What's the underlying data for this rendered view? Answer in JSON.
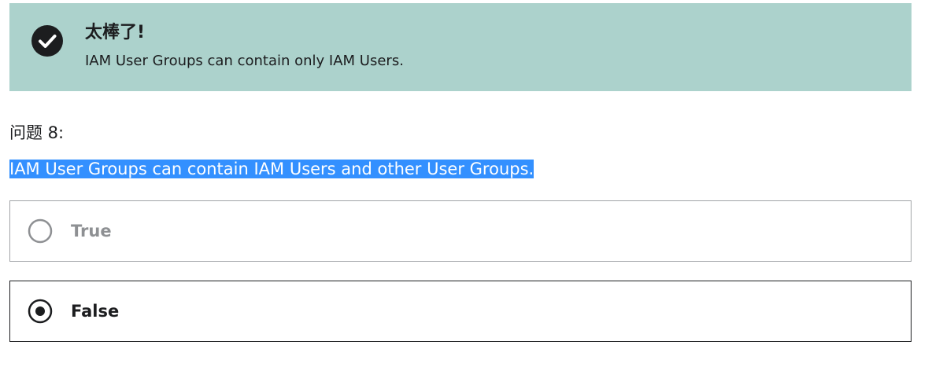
{
  "feedback": {
    "title": "太棒了!",
    "message": "IAM User Groups can contain only IAM Users.",
    "icon": "check-circle-icon",
    "background_color": "#acd2cc"
  },
  "question": {
    "number_label": "问题 8:",
    "text": "IAM User Groups can contain IAM Users and other User Groups.",
    "highlight_color": "#3390ff"
  },
  "options": [
    {
      "label": "True",
      "selected": false
    },
    {
      "label": "False",
      "selected": true
    }
  ]
}
